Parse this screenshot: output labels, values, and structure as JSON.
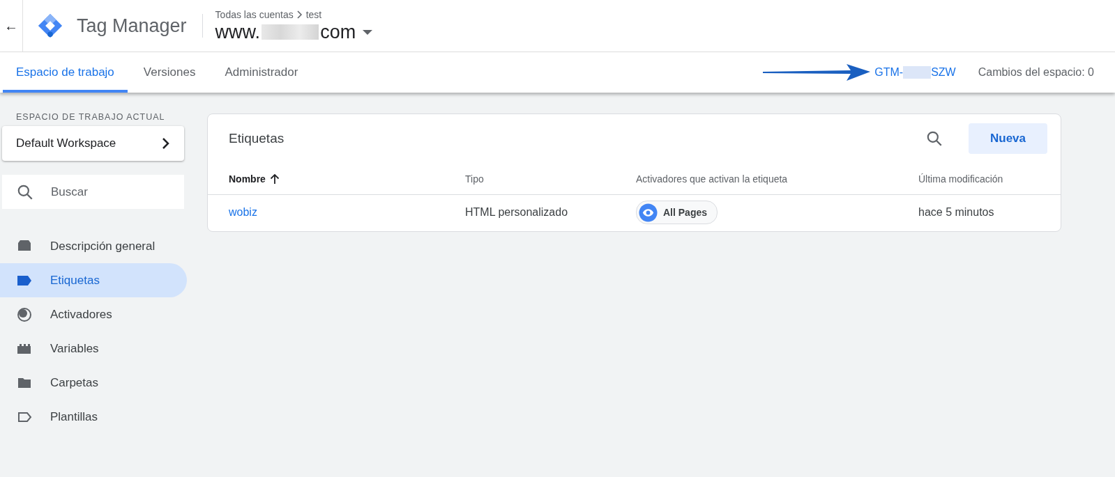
{
  "header": {
    "back": "←",
    "product": "Tag Manager",
    "breadcrumb": [
      "Todas las cuentas",
      "test"
    ],
    "container": {
      "prefix": "www.",
      "suffix": "com"
    }
  },
  "tabs": [
    {
      "label": "Espacio de trabajo",
      "selected": true
    },
    {
      "label": "Versiones",
      "selected": false
    },
    {
      "label": "Administrador",
      "selected": false
    }
  ],
  "container_id": {
    "prefix": "GTM-",
    "suffix": "SZW"
  },
  "workspace_changes": "Cambios del espacio: 0",
  "sidebar": {
    "section_label": "ESPACIO DE TRABAJO ACTUAL",
    "workspace": "Default Workspace",
    "search": {
      "placeholder": "Buscar"
    },
    "items": [
      {
        "label": "Descripción general",
        "kind": "overview",
        "selected": false
      },
      {
        "label": "Etiquetas",
        "kind": "tag",
        "selected": true
      },
      {
        "label": "Activadores",
        "kind": "trigger",
        "selected": false
      },
      {
        "label": "Variables",
        "kind": "variable",
        "selected": false
      },
      {
        "label": "Carpetas",
        "kind": "folder",
        "selected": false
      },
      {
        "label": "Plantillas",
        "kind": "template",
        "selected": false
      }
    ]
  },
  "card": {
    "title": "Etiquetas",
    "new_button": "Nueva",
    "columns": [
      {
        "label": "Nombre",
        "sorted": true
      },
      {
        "label": "Tipo",
        "sorted": false
      },
      {
        "label": "Activadores que activan la etiqueta",
        "sorted": false
      },
      {
        "label": "Última modificación",
        "sorted": false
      }
    ],
    "rows": [
      {
        "name": "wobiz",
        "type": "HTML personalizado",
        "trigger": "All Pages",
        "modified": "hace 5 minutos"
      }
    ]
  }
}
